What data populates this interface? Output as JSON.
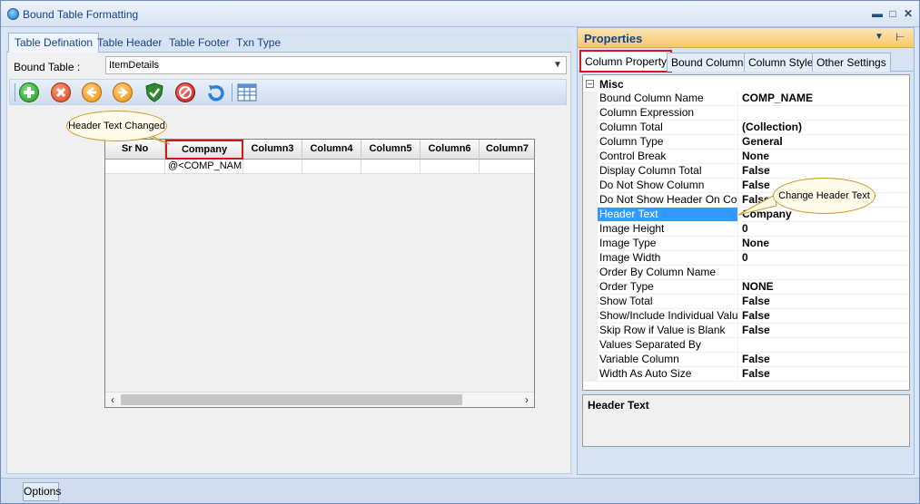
{
  "window": {
    "title": "Bound Table Formatting"
  },
  "left": {
    "tabs": [
      {
        "label": "Table Defination"
      },
      {
        "label": "Table Header"
      },
      {
        "label": "Table Footer"
      },
      {
        "label": "Txn Type"
      }
    ],
    "bound_table_label": "Bound Table :",
    "bound_table_value": "ItemDetails",
    "toolbar_icons": [
      "add-icon",
      "delete-icon",
      "move-left-icon",
      "move-right-icon",
      "validate-shield-icon",
      "stop-icon",
      "refresh-icon",
      "grid-layout-icon"
    ],
    "grid": {
      "columns": [
        "Sr No",
        "Company",
        "Column3",
        "Column4",
        "Column5",
        "Column6",
        "Column7"
      ],
      "row": [
        "",
        "@<COMP_NAM",
        "",
        "",
        "",
        "",
        ""
      ]
    },
    "callout": "Header Text Changed"
  },
  "right": {
    "title": "Properties",
    "tabs": [
      {
        "label": "Column Property"
      },
      {
        "label": "Bound Columns"
      },
      {
        "label": "Column Style"
      },
      {
        "label": "Other Settings"
      }
    ],
    "category": "Misc",
    "properties": [
      {
        "name": "Bound Column Name",
        "value": "COMP_NAME"
      },
      {
        "name": "Column Expression",
        "value": ""
      },
      {
        "name": "Column Total",
        "value": "(Collection)"
      },
      {
        "name": "Column Type",
        "value": "General"
      },
      {
        "name": "Control Break",
        "value": "None"
      },
      {
        "name": "Display Column Total",
        "value": "False"
      },
      {
        "name": "Do Not Show Column",
        "value": "False"
      },
      {
        "name": "Do Not Show Header On Contro",
        "value": "False"
      },
      {
        "name": "Header Text",
        "value": "Company"
      },
      {
        "name": "Image Height",
        "value": "0"
      },
      {
        "name": "Image Type",
        "value": "None"
      },
      {
        "name": "Image Width",
        "value": "0"
      },
      {
        "name": "Order By Column Name",
        "value": ""
      },
      {
        "name": "Order Type",
        "value": "NONE"
      },
      {
        "name": "Show Total",
        "value": "False"
      },
      {
        "name": "Show/Include Individual Values",
        "value": "False"
      },
      {
        "name": "Skip Row if Value is Blank",
        "value": "False"
      },
      {
        "name": "Values Separated By",
        "value": ""
      },
      {
        "name": "Variable Column",
        "value": "False"
      },
      {
        "name": "Width As Auto Size",
        "value": "False"
      }
    ],
    "description_title": "Header Text",
    "callout": "Change Header Text"
  },
  "statusbar": {
    "options_label": "Options"
  }
}
